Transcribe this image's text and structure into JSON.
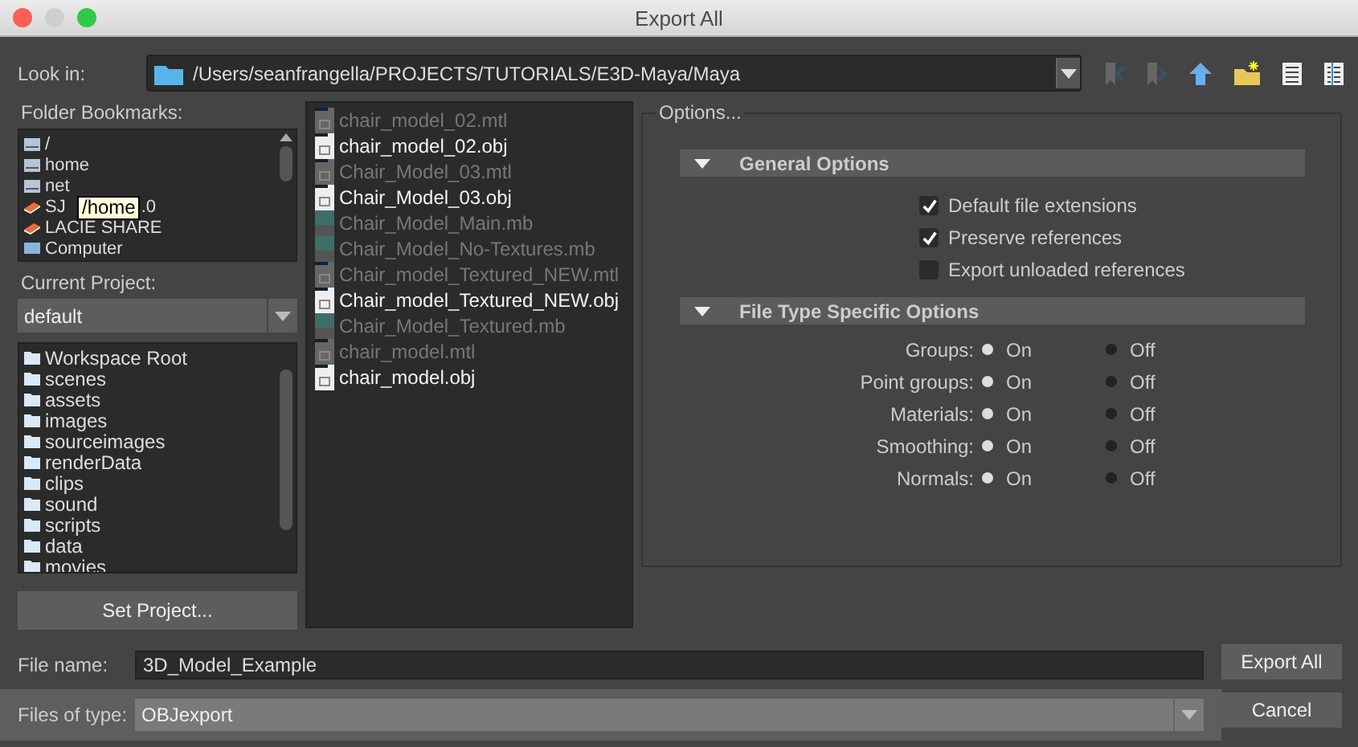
{
  "window": {
    "title": "Export All"
  },
  "look_in": {
    "label": "Look in:",
    "path": "/Users/seanfrangella/PROJECTS/TUTORIALS/E3D-Maya/Maya"
  },
  "bookmarks": {
    "label": "Folder Bookmarks:",
    "items": [
      {
        "kind": "drive",
        "text": "/"
      },
      {
        "kind": "drive",
        "text": "home"
      },
      {
        "kind": "drive",
        "text": "net"
      },
      {
        "kind": "share",
        "text": "SJ",
        "tail": ".0"
      },
      {
        "kind": "share",
        "text": "LACIE SHARE"
      },
      {
        "kind": "computer",
        "text": "Computer"
      }
    ],
    "tooltip": "/home"
  },
  "project": {
    "label": "Current Project:",
    "value": "default",
    "items": [
      "Workspace Root",
      "scenes",
      "assets",
      "images",
      "sourceimages",
      "renderData",
      "clips",
      "sound",
      "scripts",
      "data",
      "movies"
    ],
    "button": "Set Project..."
  },
  "files": [
    {
      "kind": "mtl",
      "name": "chair_model_02.mtl"
    },
    {
      "kind": "obj",
      "name": "chair_model_02.obj"
    },
    {
      "kind": "mtl",
      "name": "Chair_Model_03.mtl"
    },
    {
      "kind": "obj",
      "name": "Chair_Model_03.obj"
    },
    {
      "kind": "mb",
      "name": "Chair_Model_Main.mb"
    },
    {
      "kind": "mb",
      "name": "Chair_Model_No-Textures.mb"
    },
    {
      "kind": "mtl",
      "name": "Chair_model_Textured_NEW.mtl"
    },
    {
      "kind": "obj",
      "name": "Chair_model_Textured_NEW.obj"
    },
    {
      "kind": "mb",
      "name": "Chair_Model_Textured.mb"
    },
    {
      "kind": "mtl",
      "name": "chair_model.mtl"
    },
    {
      "kind": "obj",
      "name": "chair_model.obj"
    }
  ],
  "options": {
    "title": "Options...",
    "general": {
      "title": "General Options",
      "expanded": true,
      "checkboxes": [
        {
          "label": "Default file extensions",
          "checked": true
        },
        {
          "label": "Preserve references",
          "checked": true
        },
        {
          "label": "Export unloaded references",
          "checked": false
        }
      ]
    },
    "specific": {
      "title": "File Type Specific Options",
      "expanded": true,
      "rows": [
        {
          "label": "Groups:",
          "choices": [
            {
              "label": "On",
              "selected": true
            },
            {
              "label": "Off",
              "selected": false
            }
          ]
        },
        {
          "label": "Point groups:",
          "choices": [
            {
              "label": "On",
              "selected": true
            },
            {
              "label": "Off",
              "selected": false
            }
          ]
        },
        {
          "label": "Materials:",
          "choices": [
            {
              "label": "On",
              "selected": true
            },
            {
              "label": "Off",
              "selected": false
            }
          ]
        },
        {
          "label": "Smoothing:",
          "choices": [
            {
              "label": "On",
              "selected": true
            },
            {
              "label": "Off",
              "selected": false
            }
          ]
        },
        {
          "label": "Normals:",
          "choices": [
            {
              "label": "On",
              "selected": true
            },
            {
              "label": "Off",
              "selected": false
            }
          ]
        }
      ]
    }
  },
  "file_name": {
    "label": "File name:",
    "value": "3D_Model_Example"
  },
  "file_type": {
    "label": "Files of type:",
    "value": "OBJexport"
  },
  "buttons": [
    "Export All",
    "Cancel"
  ]
}
